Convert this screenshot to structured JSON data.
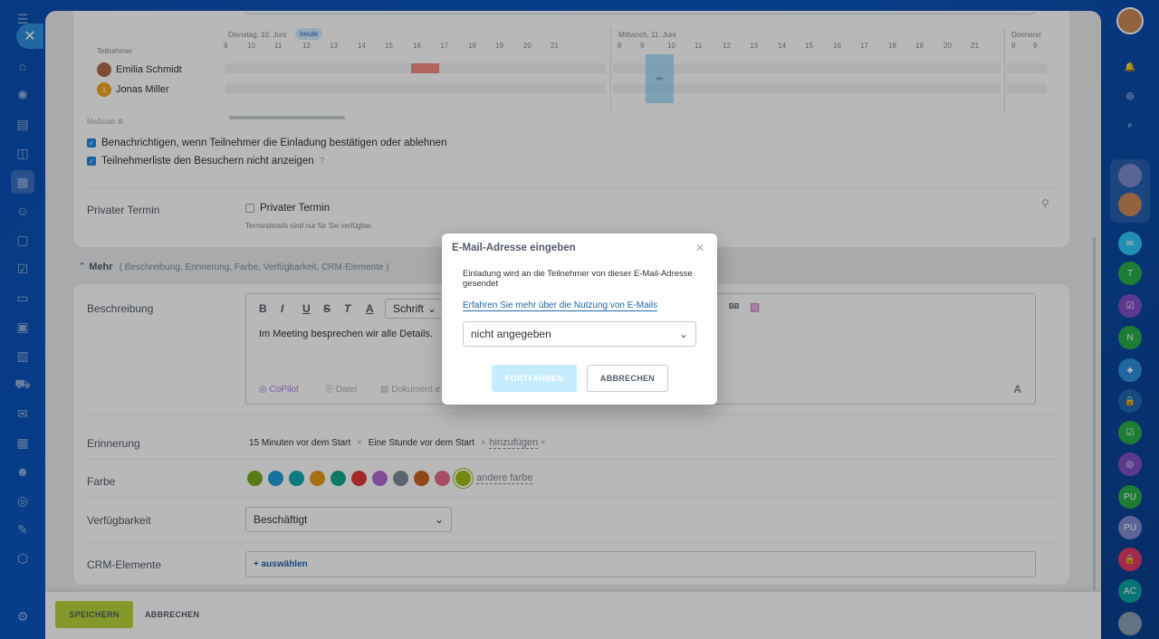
{
  "planner": {
    "participants_label": "Teilnehmer",
    "day1": "Dienstag, 10. Juni",
    "today": "heute",
    "day2": "Mittwoch, 11. Juni",
    "day3": "Donnerst",
    "hours_day1": [
      "9",
      "10",
      "11",
      "12",
      "13",
      "14",
      "15",
      "16",
      "17",
      "18",
      "19",
      "20",
      "21"
    ],
    "hours_day2": [
      "8",
      "9",
      "10",
      "11",
      "12",
      "13",
      "14",
      "15",
      "16",
      "17",
      "18",
      "19",
      "20",
      "21"
    ],
    "hours_day3": [
      "8",
      "9"
    ],
    "participants": [
      "Emilia Schmidt",
      "Jonas Miller"
    ],
    "scale_label": "Maßstab"
  },
  "options": {
    "notify": "Benachrichtigen, wenn Teilnehmer die Einladung bestätigen oder ablehnen",
    "hide_list": "Teilnehmerliste den Besuchern nicht anzeigen"
  },
  "private": {
    "row_label": "Privater Termin",
    "checkbox_label": "Privater Termin",
    "hint": "Termindetails sind nur für Sie verfügbar."
  },
  "more": {
    "title": "Mehr",
    "subtitle": "( Beschreibung,  Erinnerung,  Farbe,  Verfügbarkeit,  CRM-Elemente )"
  },
  "description": {
    "label": "Beschreibung",
    "font_select": "Schrift",
    "text": "Im Meeting besprechen wir alle Details.",
    "copilot": "CoPilot",
    "file": "Datei",
    "document": "Dokument e"
  },
  "reminder": {
    "label": "Erinnerung",
    "items": [
      "15 Minuten vor dem Start",
      "Eine Stunde vor dem Start"
    ],
    "add": "hinzufügen"
  },
  "color": {
    "label": "Farbe",
    "other": "andere farbe",
    "swatches": [
      "#7bab1e",
      "#1e9cd6",
      "#14a9b2",
      "#e89c1a",
      "#14a88e",
      "#e23b3b",
      "#b36ad0",
      "#7e8a9a",
      "#c9631f",
      "#e86b8e",
      "#9dbe13"
    ]
  },
  "availability": {
    "label": "Verfügbarkeit",
    "value": "Beschäftigt"
  },
  "crm": {
    "label": "CRM-Elemente",
    "select": "+ auswählen"
  },
  "footer": {
    "save": "SPEICHERN",
    "cancel": "ABBRECHEN"
  },
  "modal": {
    "title": "E-Mail-Adresse eingeben",
    "description": "Einladung wird an die Teilnehmer von dieser E-Mail-Adresse gesendet",
    "link": "Erfahren Sie mehr über die Nutzung von E-Mails",
    "select_value": "nicht angegeben",
    "continue": "FORTFAHREN",
    "cancel": "ABBRECHEN"
  },
  "rightbar": {
    "initials": [
      "T",
      "N",
      "PU",
      "PU",
      "AC"
    ]
  }
}
